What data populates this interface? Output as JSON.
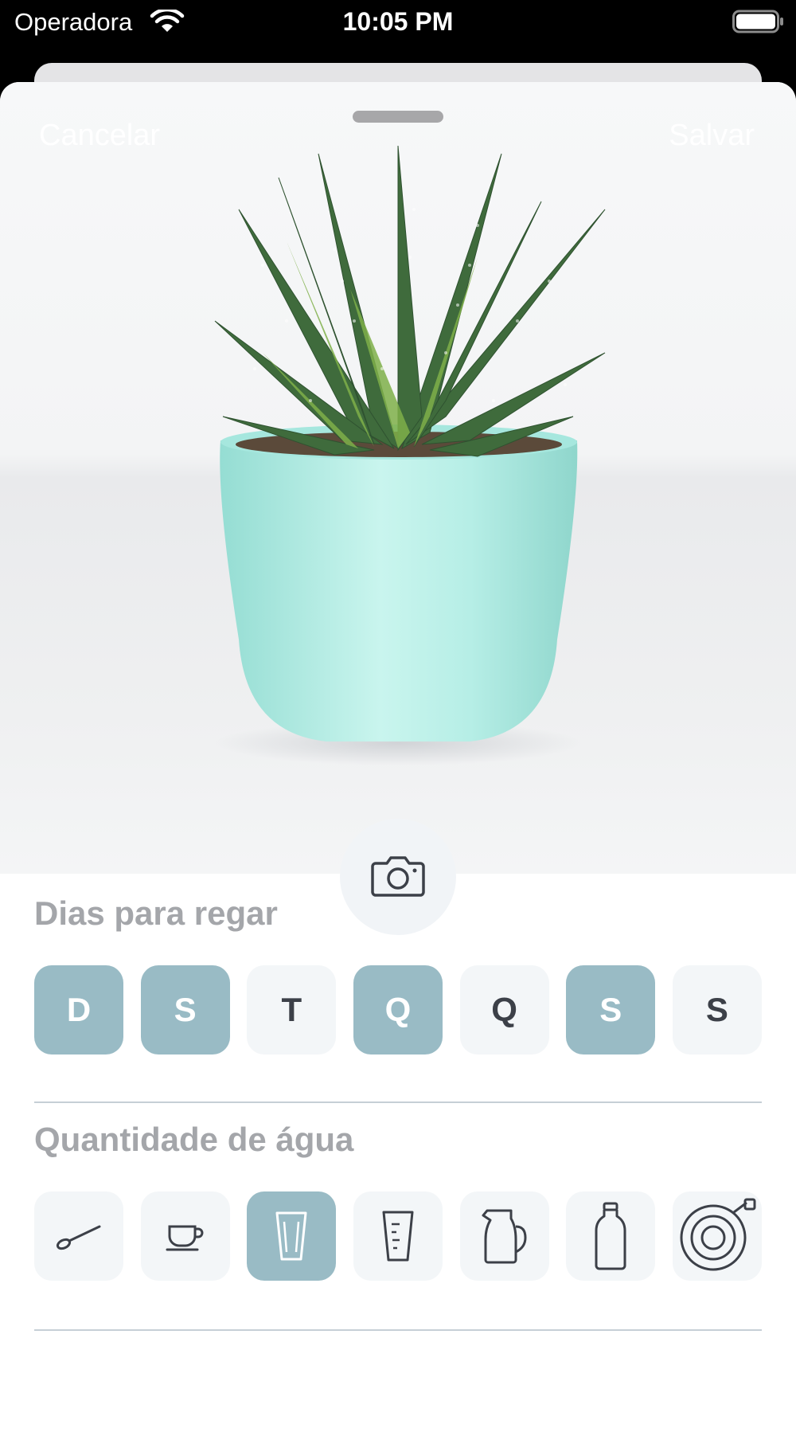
{
  "status_bar": {
    "carrier": "Operadora",
    "time": "10:05 PM"
  },
  "nav": {
    "cancel_label": "Cancelar",
    "save_label": "Salvar"
  },
  "photo": {
    "subject": "succulent-plant-in-mint-pot"
  },
  "camera_button": {
    "icon": "camera-icon"
  },
  "watering_days": {
    "title": "Dias para regar",
    "days": [
      {
        "label": "D",
        "selected": true
      },
      {
        "label": "S",
        "selected": true
      },
      {
        "label": "T",
        "selected": false
      },
      {
        "label": "Q",
        "selected": true
      },
      {
        "label": "Q",
        "selected": false
      },
      {
        "label": "S",
        "selected": true
      },
      {
        "label": "S",
        "selected": false
      }
    ]
  },
  "water_amount": {
    "title": "Quantidade de água",
    "options": [
      {
        "icon": "spoon-icon",
        "selected": false
      },
      {
        "icon": "cup-icon",
        "selected": false
      },
      {
        "icon": "glass-icon",
        "selected": true
      },
      {
        "icon": "measuring-cup-icon",
        "selected": false
      },
      {
        "icon": "pitcher-icon",
        "selected": false
      },
      {
        "icon": "bottle-icon",
        "selected": false
      },
      {
        "icon": "hose-icon",
        "selected": false
      }
    ]
  },
  "colors": {
    "accent": "#99bbc5",
    "chip_background": "#f3f6f8",
    "title_gray": "#a4a6aa",
    "pot": "#aee8e0",
    "leaf": "#3f6b3c"
  }
}
